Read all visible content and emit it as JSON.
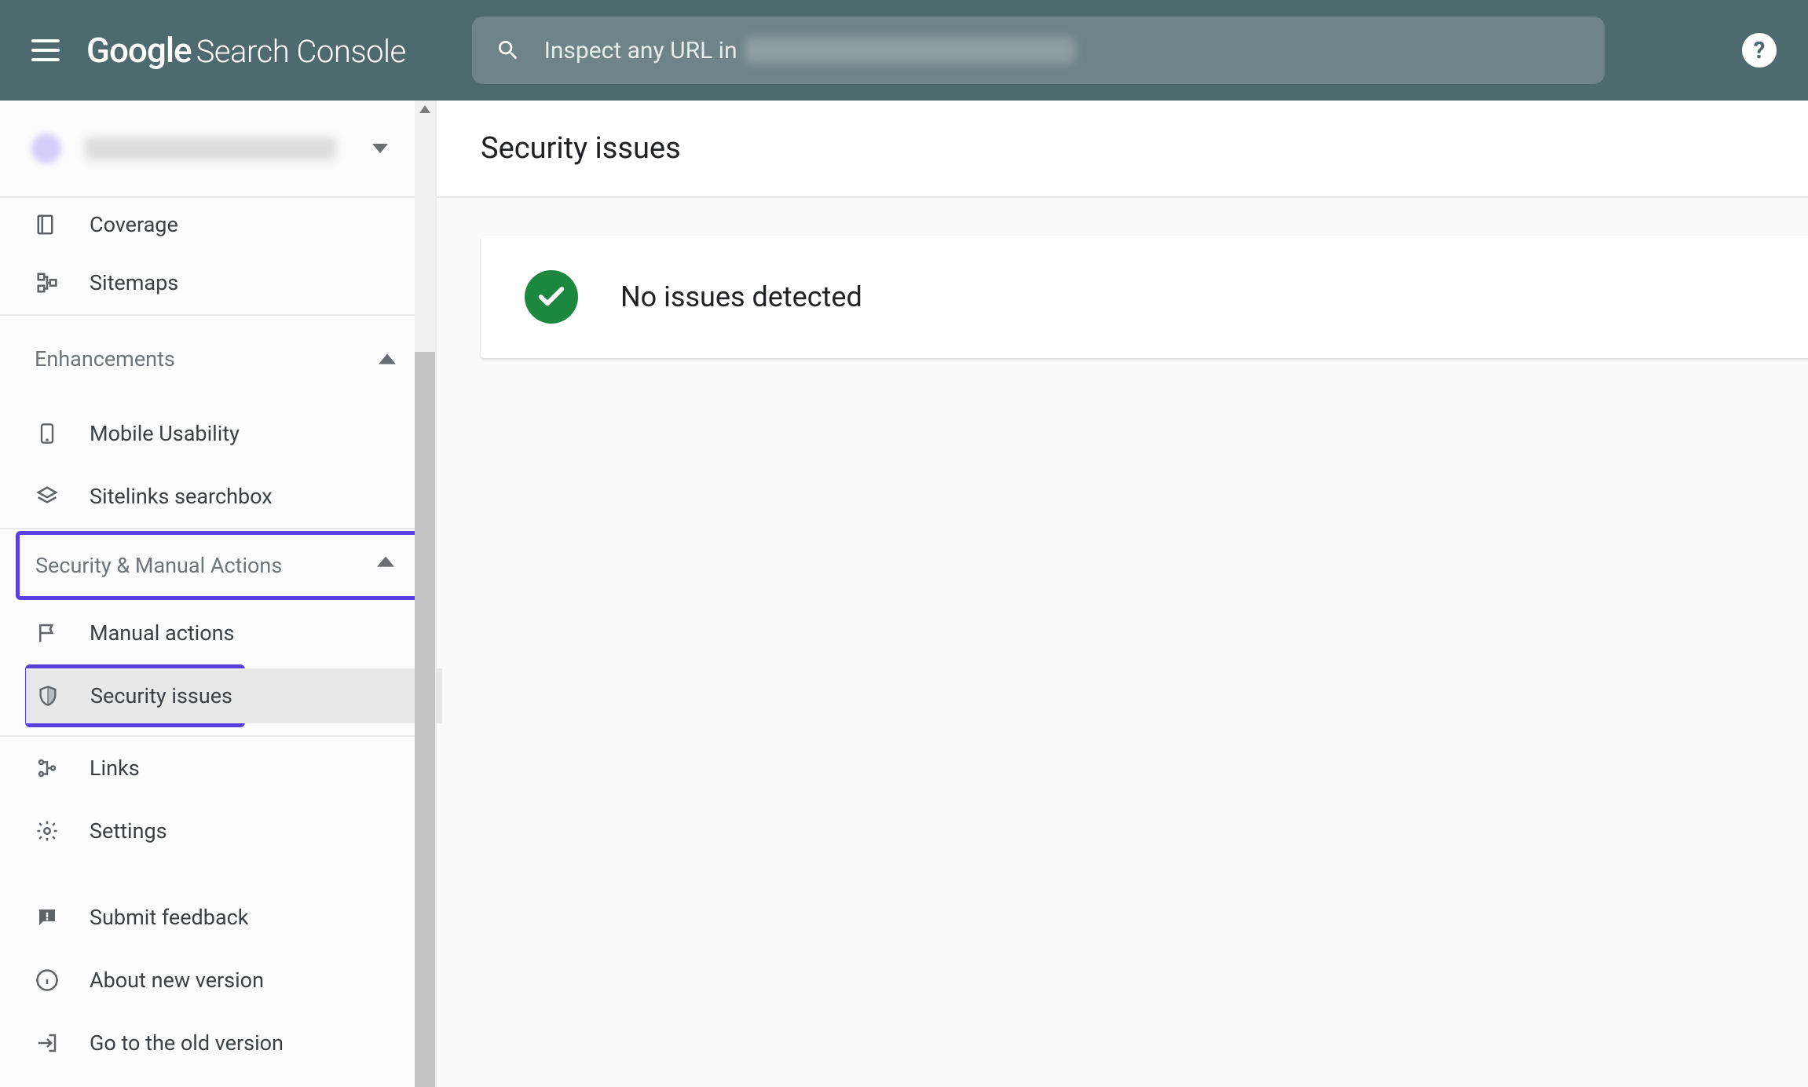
{
  "header": {
    "logo_google": "Google",
    "logo_product": "Search Console",
    "search_placeholder": "Inspect any URL in",
    "help_label": "?"
  },
  "sidebar": {
    "items": [
      {
        "label": "Coverage",
        "icon": "coverage-icon"
      },
      {
        "label": "Sitemaps",
        "icon": "sitemap-icon"
      }
    ],
    "section_enhancements": {
      "title": "Enhancements",
      "items": [
        {
          "label": "Mobile Usability",
          "icon": "phone-icon"
        },
        {
          "label": "Sitelinks searchbox",
          "icon": "layers-icon"
        }
      ]
    },
    "section_security": {
      "title": "Security & Manual Actions",
      "items": [
        {
          "label": "Manual actions",
          "icon": "flag-icon"
        },
        {
          "label": "Security issues",
          "icon": "shield-icon"
        }
      ]
    },
    "misc": [
      {
        "label": "Links",
        "icon": "links-icon"
      },
      {
        "label": "Settings",
        "icon": "gear-icon"
      }
    ],
    "footer": [
      {
        "label": "Submit feedback",
        "icon": "feedback-icon"
      },
      {
        "label": "About new version",
        "icon": "info-icon"
      },
      {
        "label": "Go to the old version",
        "icon": "exit-icon"
      }
    ]
  },
  "page": {
    "title": "Security issues",
    "status_message": "No issues detected"
  },
  "colors": {
    "accent_highlight": "#5a3fe0",
    "status_ok": "#1b873f",
    "header_bg": "#4f6a6f"
  }
}
